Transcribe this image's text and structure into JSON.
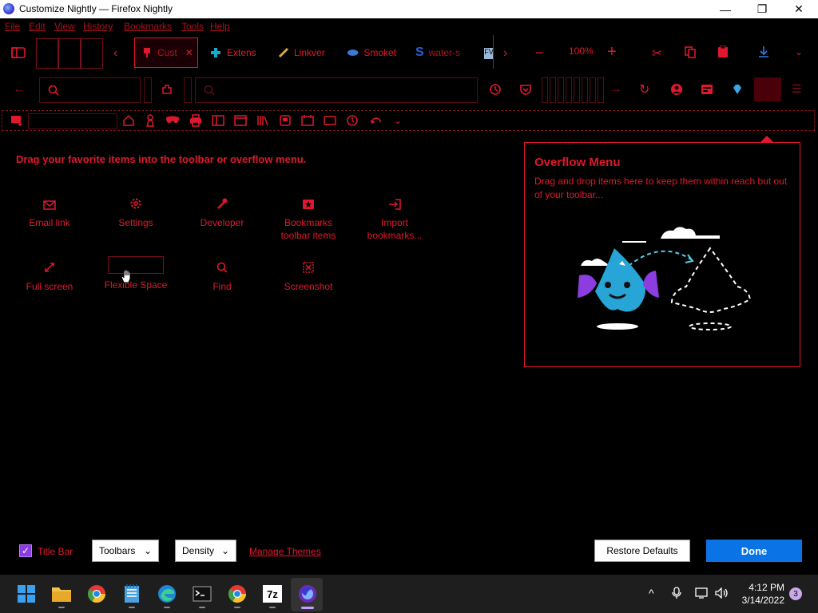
{
  "window": {
    "title": "Customize Nightly — Firefox Nightly",
    "minimize": "—",
    "restore": "❐",
    "close": "✕"
  },
  "menubar": [
    "File",
    "Edit",
    "View",
    "History",
    "Bookmarks",
    "Tools",
    "Help"
  ],
  "tabs": [
    {
      "label": "Cust",
      "active": true
    },
    {
      "label": "Extens"
    },
    {
      "label": "Linkver"
    },
    {
      "label": "Smoket"
    },
    {
      "label": "water-s"
    }
  ],
  "toolbar": {
    "zoom": "100%"
  },
  "customize": {
    "heading": "Drag your favorite items into the toolbar or overflow menu.",
    "palette": [
      {
        "label": "Email link",
        "icon": "envelope-icon"
      },
      {
        "label": "Settings",
        "icon": "gear-icon"
      },
      {
        "label": "Developer",
        "icon": "wrench-icon"
      },
      {
        "label": "Bookmarks toolbar items",
        "icon": "bookmark-star-icon"
      },
      {
        "label": "Import bookmarks...",
        "icon": "import-icon"
      },
      {
        "label": "Full screen",
        "icon": "fullscreen-icon"
      },
      {
        "label": "Flexible Space",
        "icon": "flexible-space"
      },
      {
        "label": "Find",
        "icon": "magnifier-icon"
      },
      {
        "label": "Screenshot",
        "icon": "screenshot-icon"
      }
    ],
    "overflow": {
      "title": "Overflow Menu",
      "desc": "Drag and drop items here to keep them within reach but out of your toolbar..."
    }
  },
  "footer": {
    "title_bar_label": "Title Bar",
    "title_bar_checked": true,
    "toolbars_label": "Toolbars",
    "density_label": "Density",
    "manage_themes": "Manage Themes",
    "restore_defaults": "Restore Defaults",
    "done": "Done"
  },
  "taskbar": {
    "time": "4:12 PM",
    "date": "3/14/2022",
    "notifications": "3",
    "sevenzip": "7z"
  },
  "colors": {
    "accent": "#e0182d",
    "done_button": "#0a73e6",
    "background": "#000000"
  }
}
